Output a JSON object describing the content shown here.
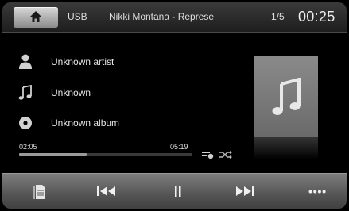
{
  "header": {
    "home_icon": "home-icon",
    "source": "USB",
    "track_title": "Nikki Montana - Represe",
    "track_index": "1/5",
    "clock": "00:25"
  },
  "track_info": {
    "artist": "Unknown artist",
    "title": "Unknown",
    "album": "Unknown album"
  },
  "playback": {
    "elapsed": "02:05",
    "total": "05:19",
    "progress_fraction": 0.39
  },
  "album_art": {
    "icon": "music-note-icon"
  },
  "controls": {
    "browse": "browse-icon",
    "previous": "previous-icon",
    "pause": "pause-icon",
    "next": "next-icon",
    "more": "more-icon"
  },
  "colors": {
    "home_button": "#c8c8c8",
    "bottom_bar": "#5e5e5e",
    "progress_fill": "#9a9a9a",
    "album_art_bg": "#7a7a7a"
  }
}
